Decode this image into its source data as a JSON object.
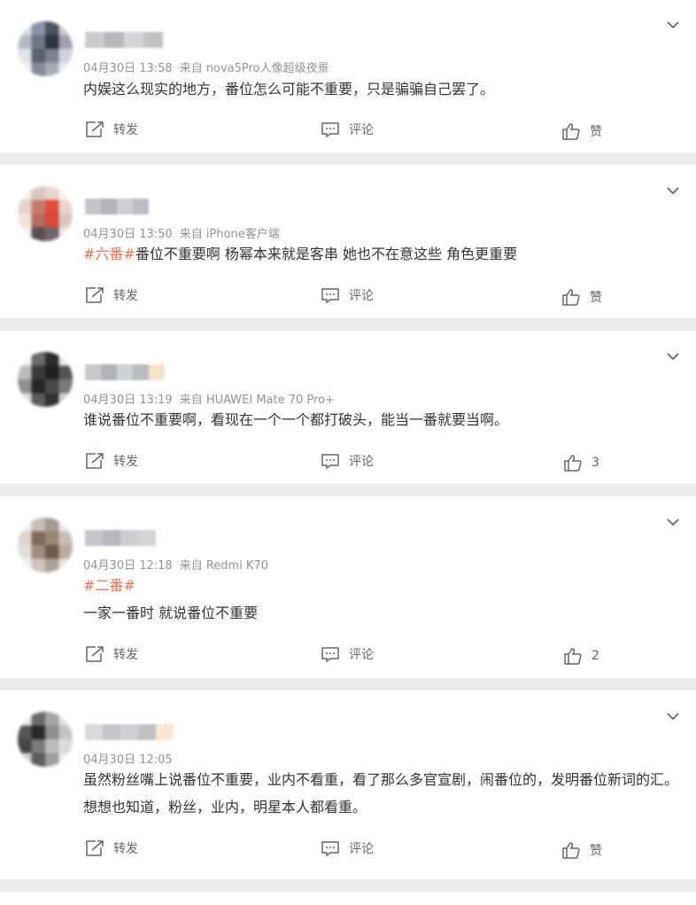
{
  "posts": [
    {
      "time": "04月30日 13:58",
      "source": "来自 nova5Pro人像超级夜景",
      "text_parts": [
        {
          "t": "内娱这么现实的地方，番位怎么可能不重要，只是骗骗自己罢了。",
          "tag": false
        }
      ],
      "repost_label": "转发",
      "comment_label": "评论",
      "like_label": "赞"
    },
    {
      "time": "04月30日 13:50",
      "source": "来自 iPhone客户端",
      "text_parts": [
        {
          "t": "#六番#",
          "tag": true
        },
        {
          "t": "番位不重要啊 杨幂本来就是客串 她也不在意这些 角色更重要",
          "tag": false
        }
      ],
      "repost_label": "转发",
      "comment_label": "评论",
      "like_label": "赞"
    },
    {
      "time": "04月30日 13:19",
      "source": "来自 HUAWEI Mate 70 Pro+",
      "text_parts": [
        {
          "t": "谁说番位不重要啊，看现在一个一个都打破头，能当一番就要当啊。",
          "tag": false
        }
      ],
      "repost_label": "转发",
      "comment_label": "评论",
      "like_label": "3"
    },
    {
      "time": "04月30日 12:18",
      "source": "来自 Redmi K70",
      "text_parts": [
        {
          "t": "#二番#",
          "tag": true
        }
      ],
      "text_line2": "一家一番时 就说番位不重要",
      "repost_label": "转发",
      "comment_label": "评论",
      "like_label": "2"
    },
    {
      "time": "04月30日 12:05",
      "source": "",
      "text_parts": [
        {
          "t": "虽然粉丝嘴上说番位不重要，业内不看重，看了那么多官宣剧，闹番位的，发明番位新词的汇。想想也知道，粉丝，业内，明星本人都看重。",
          "tag": false
        }
      ],
      "repost_label": "转发",
      "comment_label": "评论",
      "like_label": "赞"
    }
  ],
  "colors": {
    "tag": "#eb7350",
    "meta": "#939393",
    "divider": "#ececec"
  },
  "icons": {
    "repost": "repost-icon",
    "comment": "comment-icon",
    "like": "thumbs-up-icon",
    "menu": "chevron-down-icon"
  }
}
